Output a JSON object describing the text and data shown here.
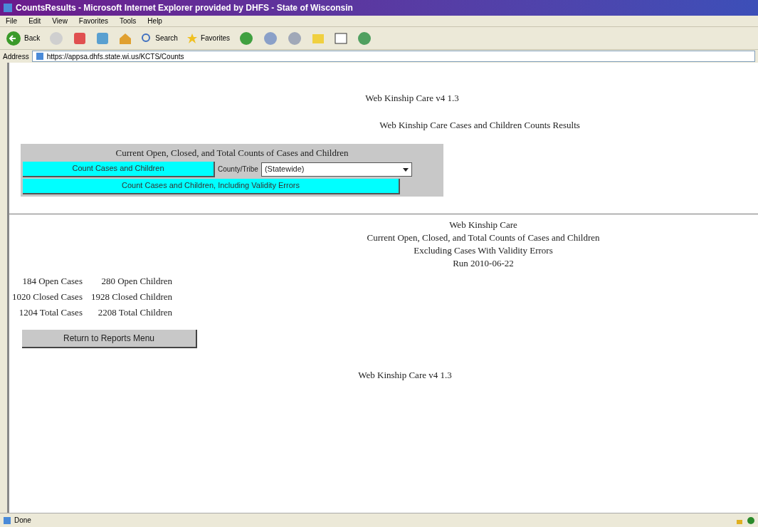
{
  "window": {
    "title": "CountsResults - Microsoft Internet Explorer provided by DHFS - State of Wisconsin"
  },
  "menu": [
    "File",
    "Edit",
    "View",
    "Favorites",
    "Tools",
    "Help"
  ],
  "toolbar": {
    "back": "Back",
    "search": "Search",
    "favorites": "Favorites"
  },
  "address": {
    "label": "Address",
    "value": "https://appsa.dhfs.state.wi.us/KCTS/Counts"
  },
  "page": {
    "header": "Web Kinship Care v4 1.3",
    "subtitle": "Web Kinship Care Cases and Children Counts Results",
    "form": {
      "title": "Current Open, Closed, and Total Counts of Cases and Children",
      "count_button": "Count Cases and Children",
      "county_label": "County/Tribe",
      "county_value": "(Statewide)",
      "count_errors_button": "Count Cases and Children, Including Validity Errors"
    },
    "report_title": [
      "Web Kinship Care",
      "Current Open, Closed, and Total Counts of Cases and Children",
      "Excluding Cases With Validity Errors",
      "Run 2010-06-22"
    ],
    "counts": [
      [
        "184 Open Cases",
        "280 Open Children"
      ],
      [
        "1020 Closed Cases",
        "1928 Closed Children"
      ],
      [
        "1204 Total Cases",
        "2208 Total Children"
      ]
    ],
    "return_button": "Return to Reports Menu",
    "footer": "Web Kinship Care v4 1.3"
  },
  "status_bar": {
    "text": "Done"
  }
}
